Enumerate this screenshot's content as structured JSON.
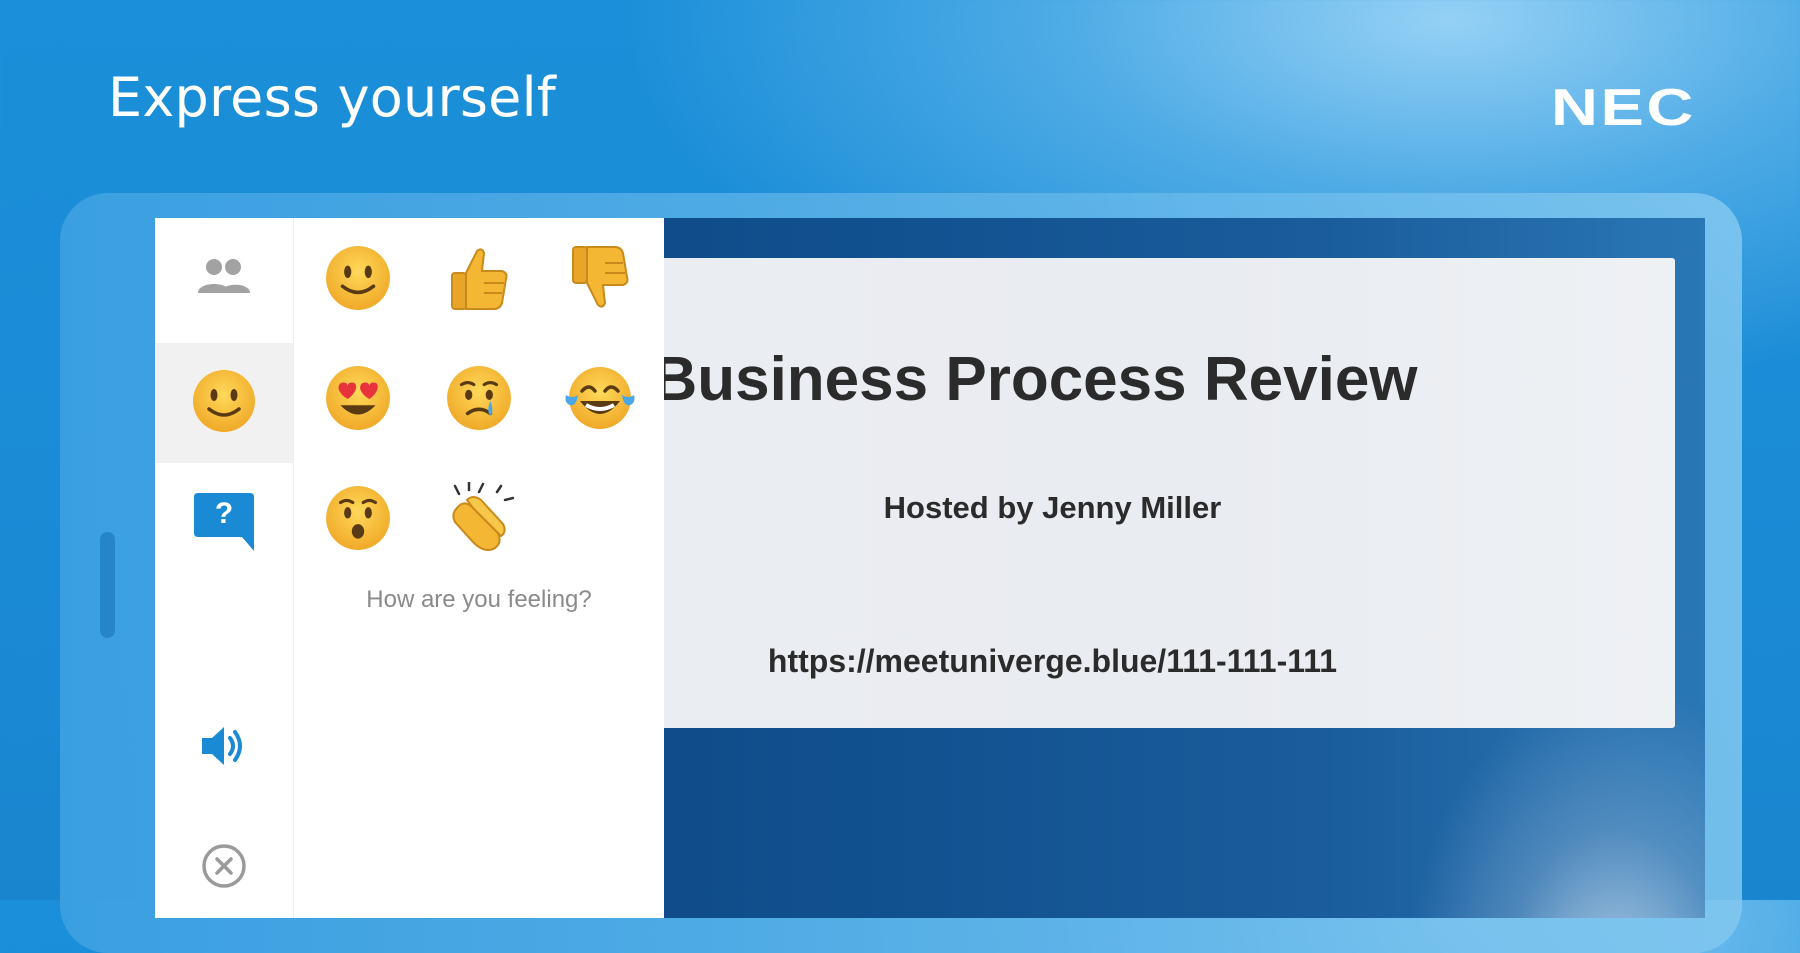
{
  "banner": {
    "headline": "Express yourself",
    "brand": "NEC"
  },
  "slide": {
    "title": "Business Process Review",
    "host": "Hosted by Jenny Miller",
    "url": "https://meetuniverge.blue/111-111-111"
  },
  "rail": {
    "items": [
      {
        "icon": "participants-icon"
      },
      {
        "icon": "smiley-face-icon",
        "active": true
      },
      {
        "icon": "question-icon",
        "glyph": "?"
      },
      {
        "icon": "speaker-icon"
      },
      {
        "icon": "close-circle-icon"
      }
    ]
  },
  "reactions": {
    "caption": "How are you feeling?",
    "items": [
      {
        "icon": "slightly-smiling-emoji"
      },
      {
        "icon": "thumbs-up-emoji"
      },
      {
        "icon": "thumbs-down-emoji"
      },
      {
        "icon": "heart-eyes-emoji"
      },
      {
        "icon": "crying-emoji"
      },
      {
        "icon": "tears-of-joy-emoji"
      },
      {
        "icon": "surprised-emoji"
      },
      {
        "icon": "clapping-hands-emoji"
      }
    ]
  },
  "colors": {
    "accent": "#1a8ad4",
    "emoji_yellow": "#f7c23a",
    "icon_gray": "#9a9a9a"
  }
}
